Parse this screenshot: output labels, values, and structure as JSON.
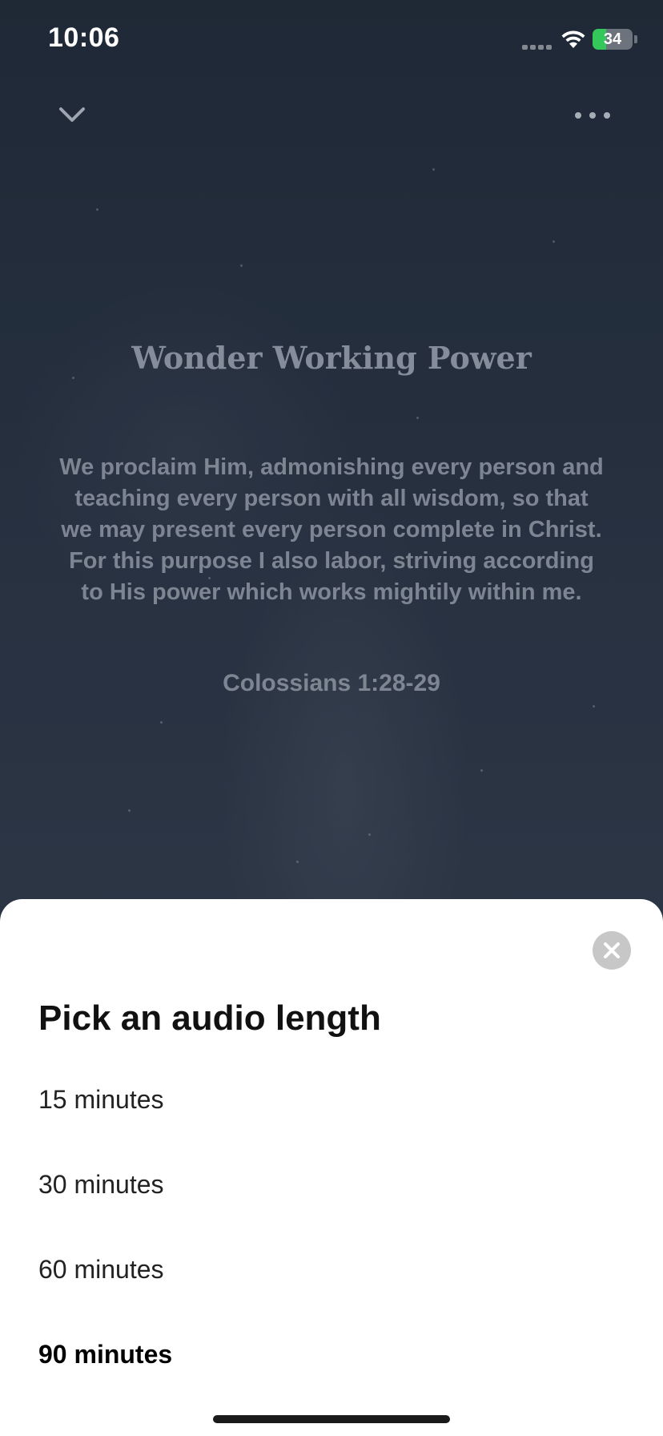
{
  "status_bar": {
    "time": "10:06",
    "battery_level": "34",
    "battery_fraction": 0.34,
    "battery_color": "#34c759"
  },
  "top_bar": {
    "dismiss_icon": "chevron-down-icon",
    "more_icon": "more-horizontal-icon"
  },
  "content": {
    "title": "Wonder Working Power",
    "verse": "We proclaim Him, admonishing every person and teaching every person with all wisdom, so that we may present every person complete in Christ. For this purpose I also labor, striving according to His power which works mightily within me.",
    "reference": "Colossians 1:28-29"
  },
  "sheet": {
    "title": "Pick an audio length",
    "close_icon": "close-icon",
    "options": [
      {
        "label": "15 minutes",
        "selected": false
      },
      {
        "label": "30 minutes",
        "selected": false
      },
      {
        "label": "60 minutes",
        "selected": false
      },
      {
        "label": "90 minutes",
        "selected": true
      }
    ]
  }
}
